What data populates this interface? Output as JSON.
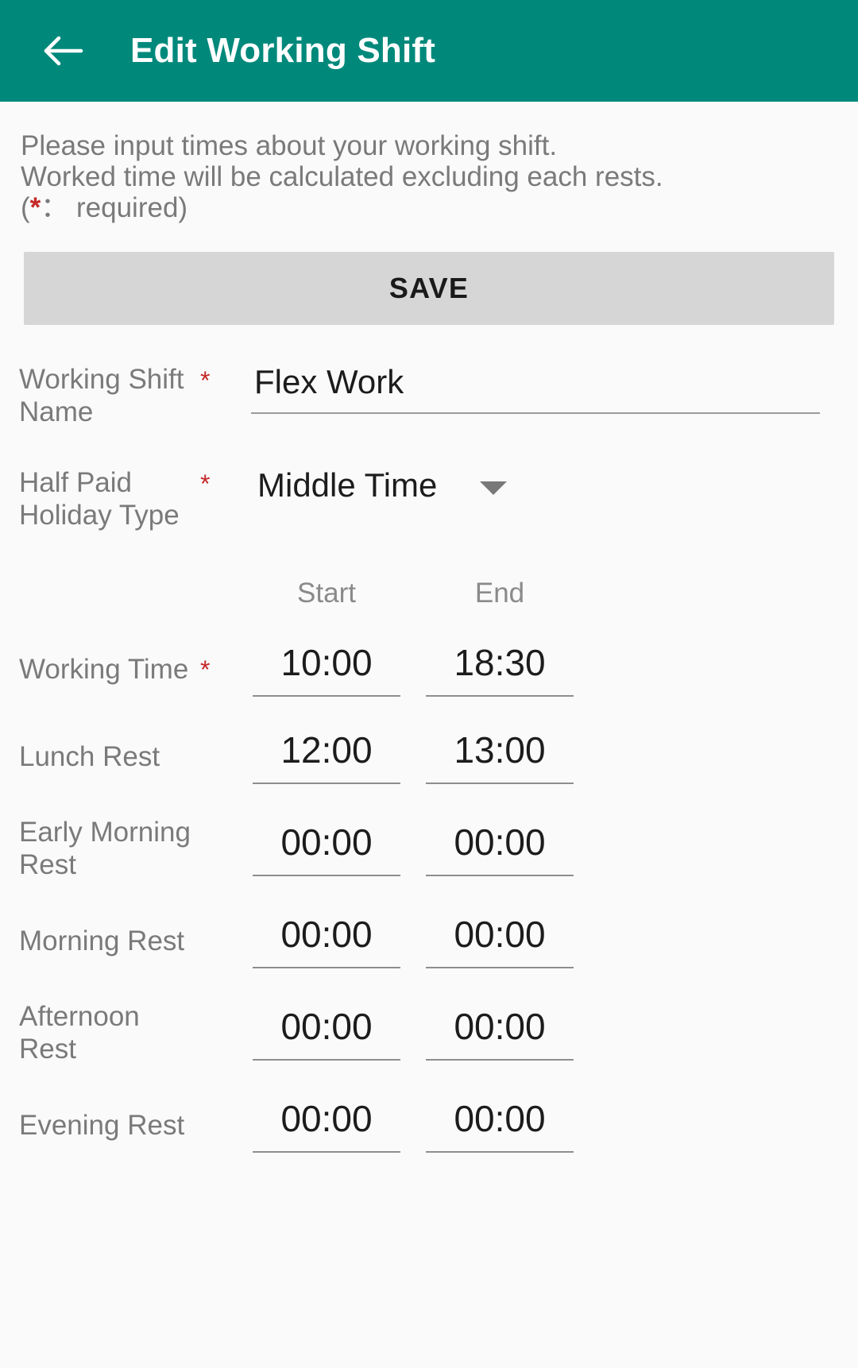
{
  "appbar": {
    "back_icon": "back-arrow-icon",
    "title": "Edit Working Shift"
  },
  "intro": {
    "line1": "Please input times about your working shift.",
    "line2": "Worked time will be calculated excluding each rests.",
    "line3_open": "(",
    "line3_star": "*",
    "line3_rest": "： required)"
  },
  "toolbar": {
    "save_label": "SAVE"
  },
  "fields": {
    "shift_name": {
      "label": "Working Shift Name",
      "required_mark": "*",
      "value": "Flex Work",
      "placeholder": "Working Shift Name"
    },
    "holiday_type": {
      "label": "Half Paid Holiday Type",
      "required_mark": "*",
      "value": "Middle Time",
      "caret_icon": "chevron-down-icon"
    }
  },
  "table": {
    "headers": {
      "start": "Start",
      "end": "End"
    },
    "rows": [
      {
        "label": "Working Time",
        "required_mark": "*",
        "start": "10:00",
        "end": "18:30",
        "name": "working-time"
      },
      {
        "label": "Lunch Rest",
        "required_mark": "",
        "start": "12:00",
        "end": "13:00",
        "name": "lunch-rest"
      },
      {
        "label": "Early Morning Rest",
        "required_mark": "",
        "start": "00:00",
        "end": "00:00",
        "name": "early-morning-rest"
      },
      {
        "label": "Morning Rest",
        "required_mark": "",
        "start": "00:00",
        "end": "00:00",
        "name": "morning-rest"
      },
      {
        "label": "Afternoon Rest",
        "required_mark": "",
        "start": "00:00",
        "end": "00:00",
        "name": "afternoon-rest"
      },
      {
        "label": "Evening Rest",
        "required_mark": "",
        "start": "00:00",
        "end": "00:00",
        "name": "evening-rest"
      }
    ]
  },
  "colors": {
    "appbar": "#00897B",
    "required": "#C62828",
    "save_button": "#D6D6D6",
    "background": "#FAFAFA",
    "label_text": "#7A7A7A",
    "value_text": "#1C1C1C",
    "underline": "#8E8E8E"
  }
}
